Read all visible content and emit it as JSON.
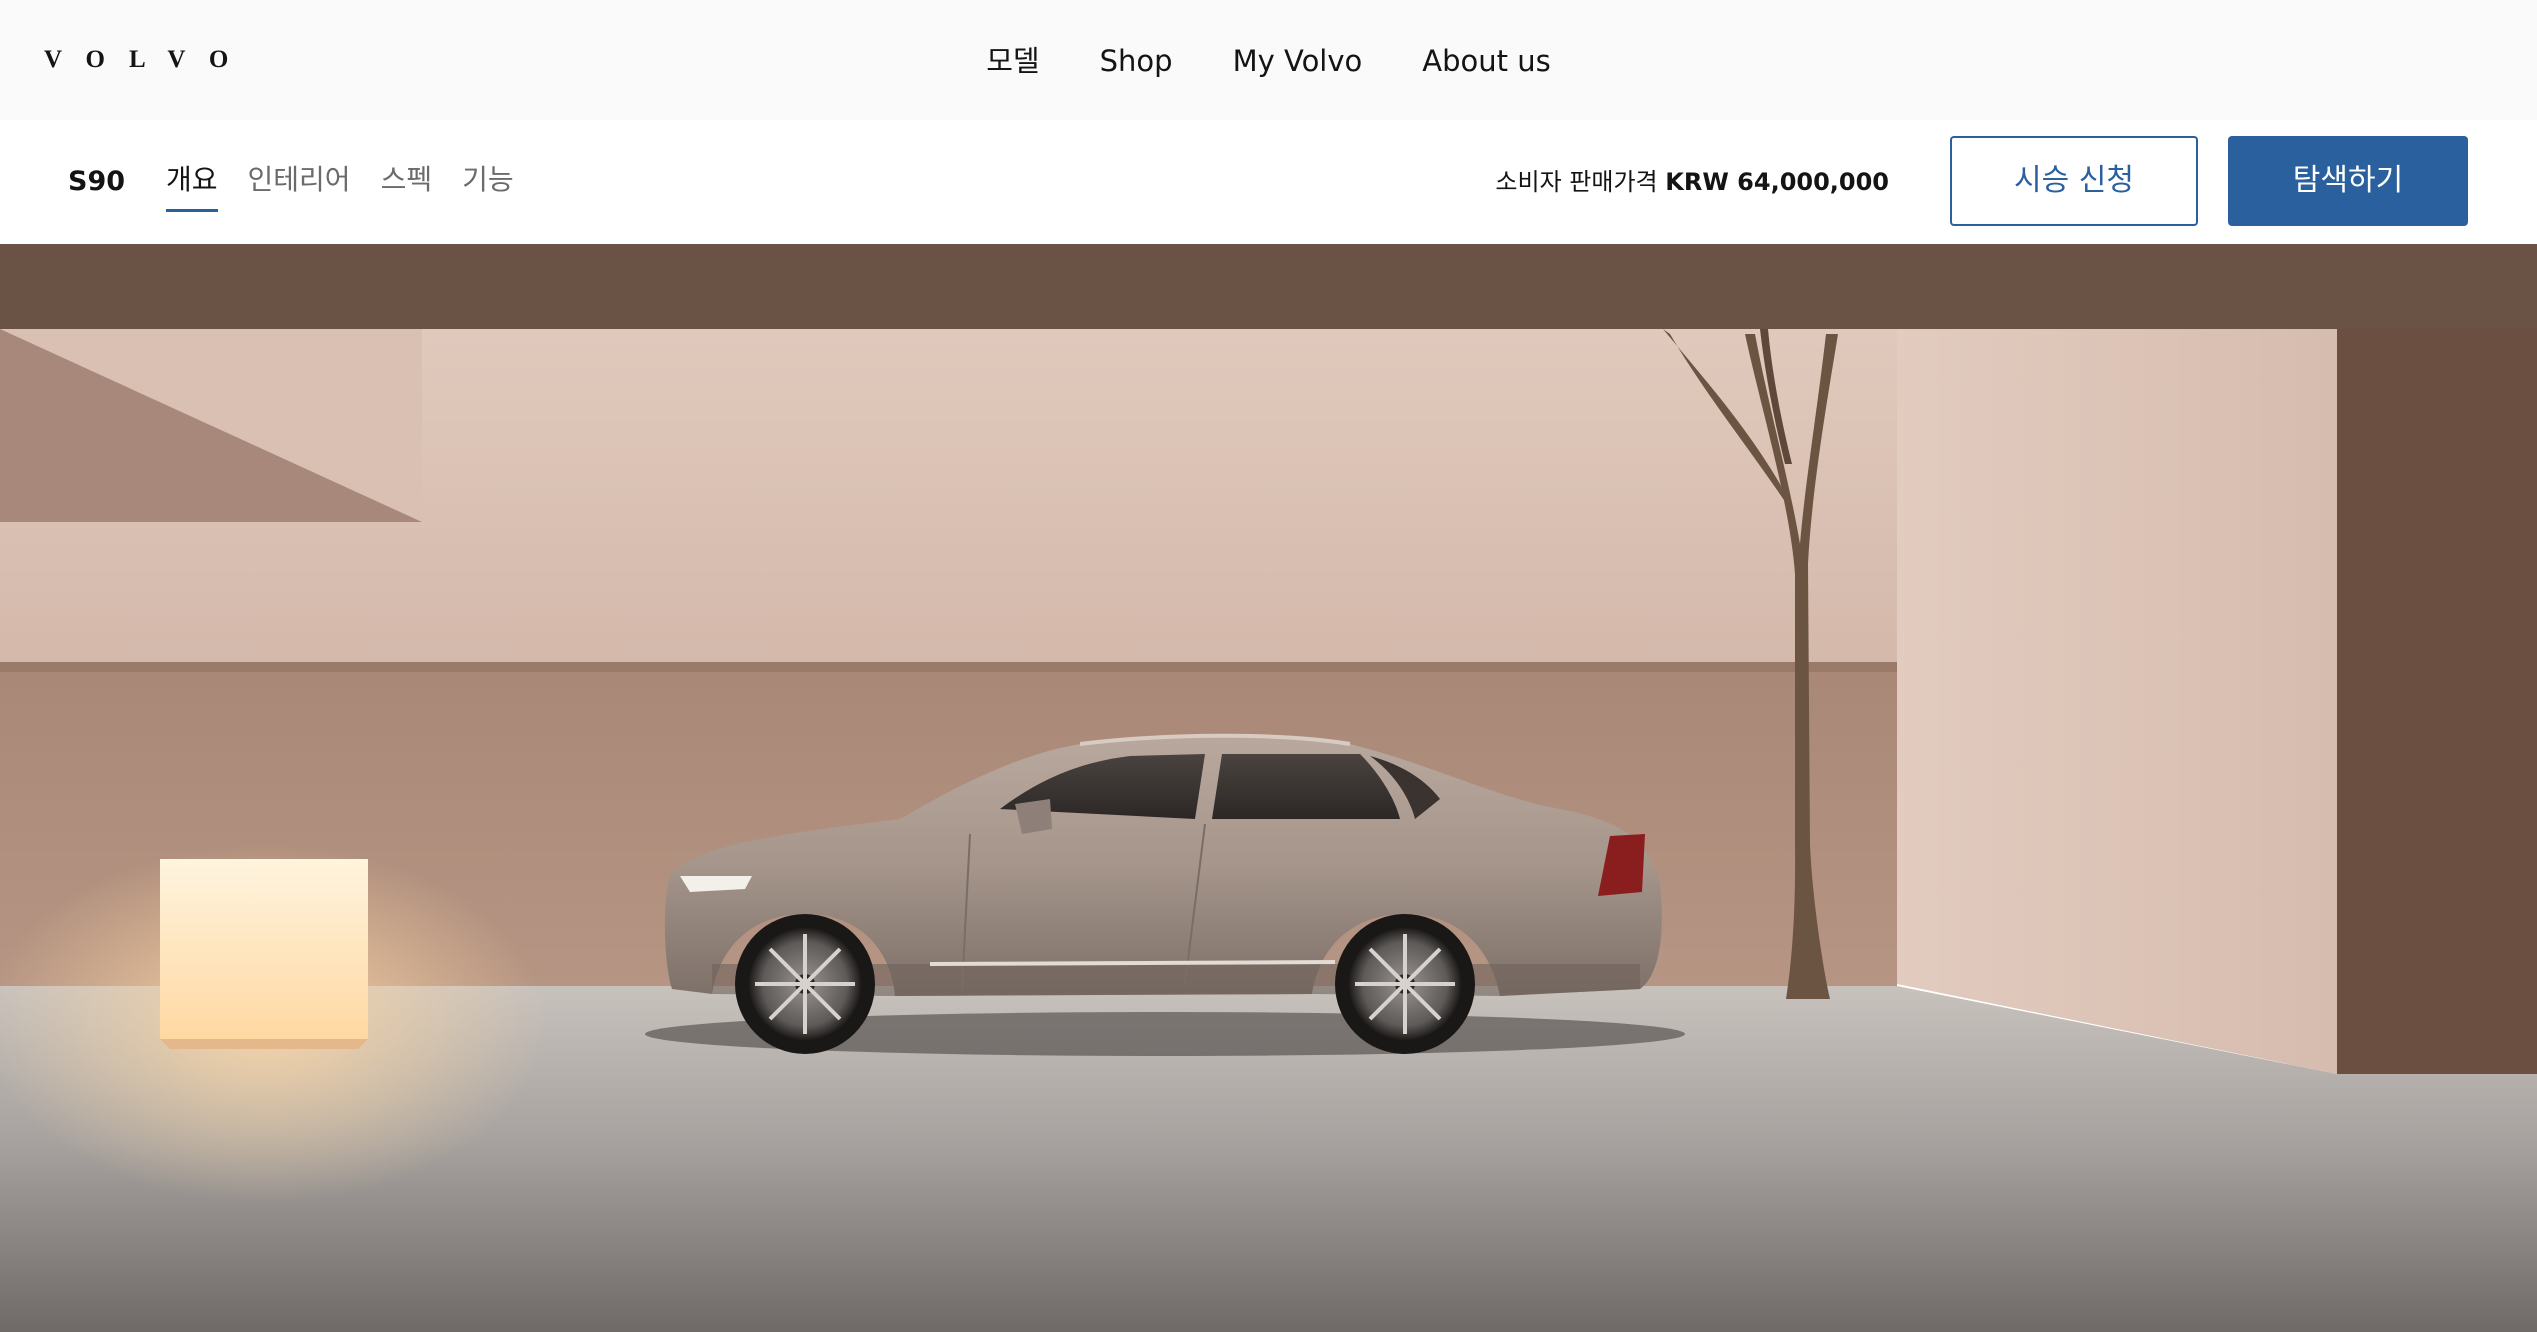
{
  "brand": {
    "logo_text": "VOLVO"
  },
  "primary_nav": {
    "items": [
      {
        "label": "모델"
      },
      {
        "label": "Shop"
      },
      {
        "label": "My Volvo"
      },
      {
        "label": "About us"
      }
    ]
  },
  "sub_nav": {
    "model": "S90",
    "tabs": [
      {
        "label": "개요",
        "active": true
      },
      {
        "label": "인테리어",
        "active": false
      },
      {
        "label": "스펙",
        "active": false
      },
      {
        "label": "기능",
        "active": false
      }
    ],
    "price_label": "소비자 판매가격",
    "price_value": "KRW 64,000,000",
    "test_drive_label": "시승 신청",
    "explore_label": "탐색하기"
  },
  "colors": {
    "accent": "#2a609d",
    "nav_background": "#fafafa"
  },
  "hero": {
    "icon": "car-hero-image"
  }
}
